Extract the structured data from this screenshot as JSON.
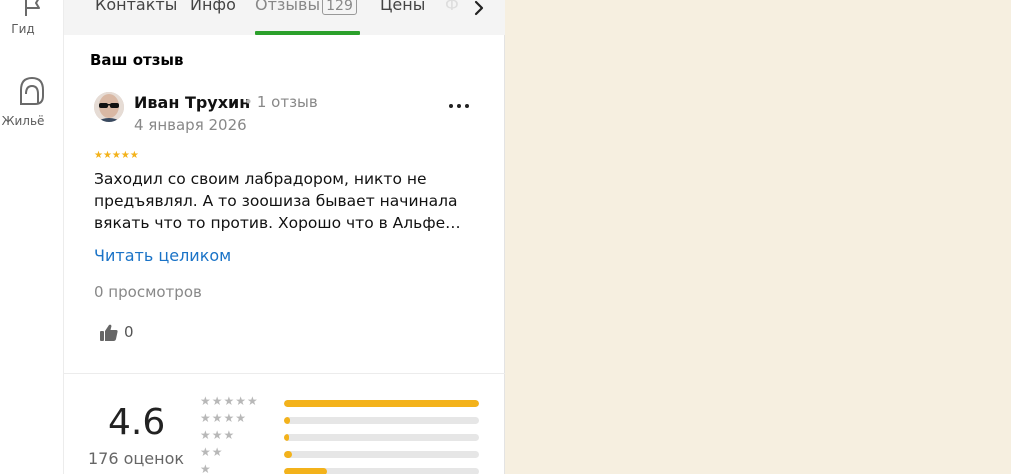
{
  "rail": {
    "items": [
      {
        "label": "Гид"
      },
      {
        "label": "Жильё"
      }
    ]
  },
  "tabs": [
    {
      "label": "Контакты"
    },
    {
      "label": "Инфо"
    },
    {
      "label": "Отзывы",
      "count": "129"
    },
    {
      "label": "Цены"
    },
    {
      "label": "Ф"
    }
  ],
  "my_review": {
    "section_title": "Ваш отзыв",
    "author": "Иван Трухин",
    "author_reviews": "1 отзыв",
    "date": "4 января 2026",
    "rating_stars": "★★★★★",
    "text": "Заходил со своим лабрадором, никто не предъявлял. А то зоошиза бывает начинала вякать что то против. Хорошо что в Альфе…",
    "read_more": "Читать целиком",
    "views": "0 просмотров",
    "likes": "0"
  },
  "rating": {
    "value": "4.6",
    "count_label": "176 оценок",
    "distribution": [
      {
        "stars": "★★★★★",
        "fraction": 1.0
      },
      {
        "stars": "★★★★",
        "fraction": 0.03
      },
      {
        "stars": "★★★",
        "fraction": 0.025
      },
      {
        "stars": "★★",
        "fraction": 0.04
      },
      {
        "stars": "★",
        "fraction": 0.22
      }
    ]
  },
  "colors": {
    "accent_green": "#2ba02b",
    "star_gold": "#f3b21b",
    "link_blue": "#1a73c7",
    "map_bg": "#f6efe0"
  }
}
